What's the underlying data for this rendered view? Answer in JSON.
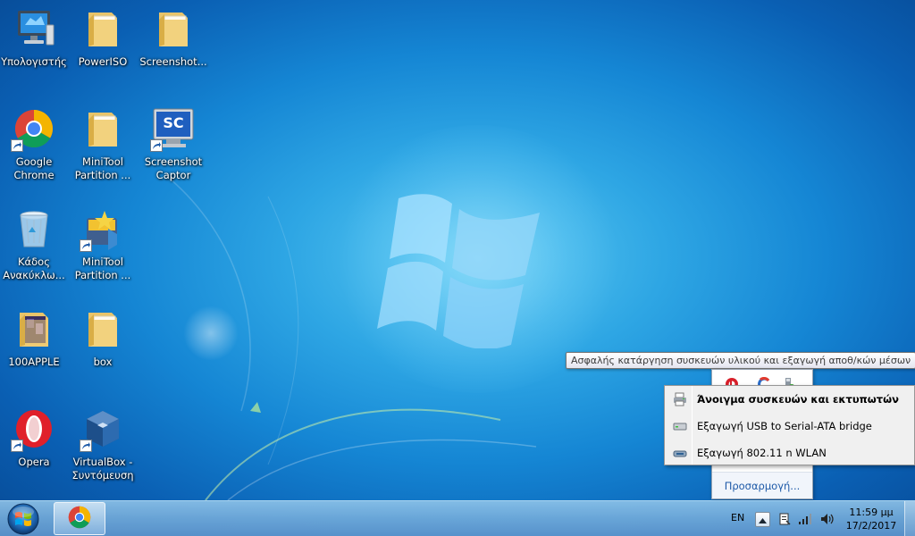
{
  "desktop": {
    "icons": [
      {
        "label": "Υπολογιστής",
        "icon": "computer-icon"
      },
      {
        "label": "PowerISO",
        "icon": "folder-icon"
      },
      {
        "label": "Screenshot...",
        "icon": "folder-icon"
      },
      {
        "label": "Google Chrome",
        "icon": "chrome-icon"
      },
      {
        "label": "MiniTool Partition ...",
        "icon": "folder-icon"
      },
      {
        "label": "Screenshot Captor",
        "icon": "screenshot-captor-icon"
      },
      {
        "label": "Κάδος Ανακύκλω...",
        "icon": "recycle-bin-icon"
      },
      {
        "label": "MiniTool Partition ...",
        "icon": "minitool-icon"
      },
      {
        "label": "100APPLE",
        "icon": "folder-icon"
      },
      {
        "label": "box",
        "icon": "folder-icon"
      },
      {
        "label": "Opera",
        "icon": "opera-icon"
      },
      {
        "label": "VirtualBox - Συντόμευση",
        "icon": "virtualbox-icon"
      }
    ],
    "screenshot_captor_badge": "SC"
  },
  "tooltip": {
    "text": "Ασφαλής κατάργηση συσκευών υλικού και εξαγωγή αποθ/κών μέσων"
  },
  "tray_popup": {
    "customize_label": "Προσαρμογή..."
  },
  "eject_menu": {
    "items": [
      {
        "label": "Άνοιγμα συσκευών και εκτυπωτών",
        "bold": true,
        "icon": "printer-icon"
      },
      {
        "label": "Εξαγωγή USB to Serial-ATA bridge",
        "bold": false,
        "icon": "drive-icon"
      },
      {
        "label": "Εξαγωγή 802.11 n WLAN",
        "bold": false,
        "icon": "network-adapter-icon"
      }
    ]
  },
  "taskbar": {
    "language": "EN",
    "clock_time": "11:59 μμ",
    "clock_date": "17/2/2017"
  },
  "colors": {
    "wallpaper_center": "#5ccaf2",
    "wallpaper_edge": "#074a95",
    "taskbar": "#78afdc",
    "link": "#1e5aa8"
  }
}
